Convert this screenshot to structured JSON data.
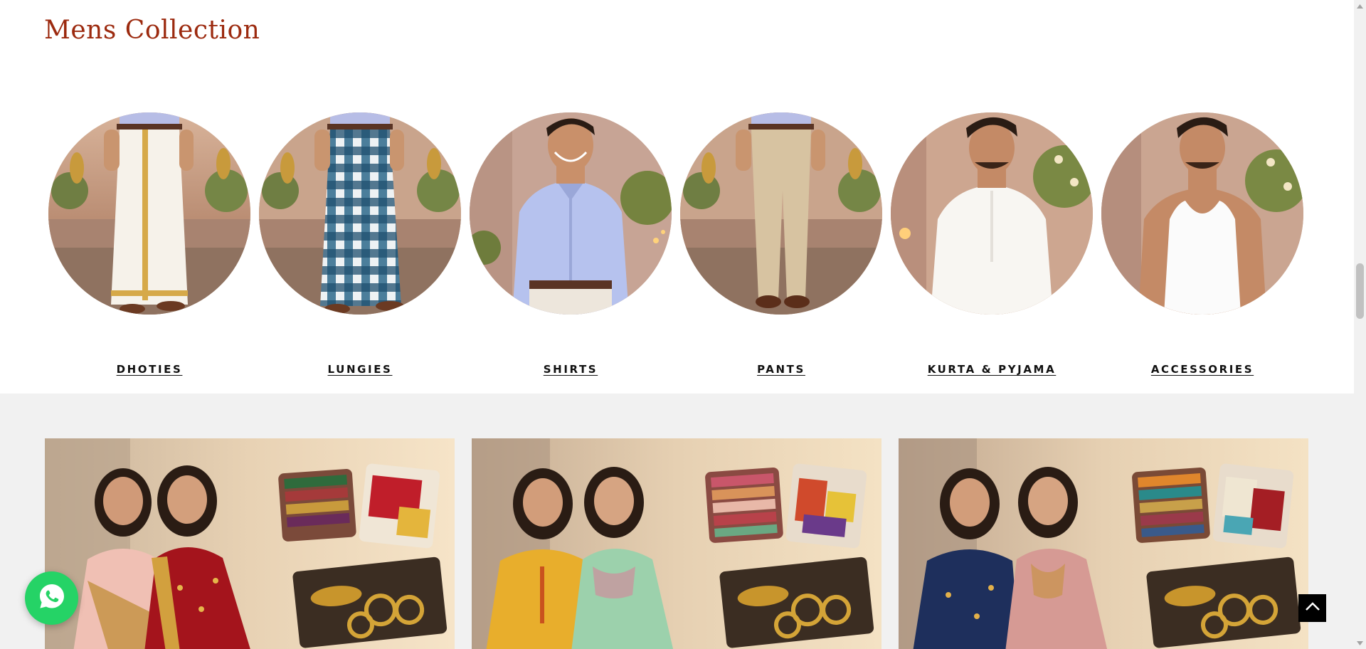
{
  "mens_collection": {
    "title": "Mens Collection",
    "categories": [
      {
        "label": "DHOTIES",
        "image": "man in white dhoti with gold border"
      },
      {
        "label": "LUNGIES",
        "image": "man in blue checked lungi"
      },
      {
        "label": "SHIRTS",
        "image": "man in light blue shirt"
      },
      {
        "label": "PANTS",
        "image": "man in beige trousers"
      },
      {
        "label": "KURTA & PYJAMA",
        "image": "man in white kurta"
      },
      {
        "label": "ACCESSORIES",
        "image": "man in white vest"
      }
    ]
  },
  "banners": [
    {
      "image": "two women in sarees with fabric and jewellery collage"
    },
    {
      "image": "two women in salwar suits with fabric and jewellery collage"
    },
    {
      "image": "two women in kurtis with fabric and jewellery collage"
    }
  ],
  "floating": {
    "whatsapp_icon": "whatsapp-icon",
    "back_to_top_icon": "chevron-up-icon"
  },
  "colors": {
    "title": "#9c2a0f",
    "whatsapp": "#25d366",
    "banner_bg": "#f1f1f1"
  }
}
